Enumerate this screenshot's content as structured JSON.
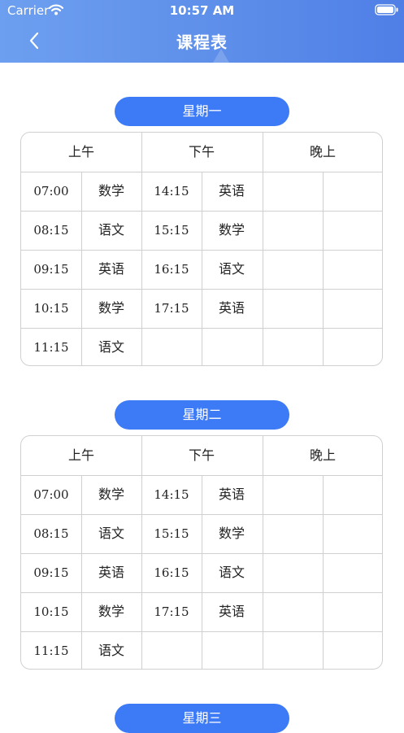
{
  "status_bar": {
    "carrier": "Carrier",
    "time": "10:57 AM"
  },
  "header": {
    "title": "课程表"
  },
  "schedule": [
    {
      "day": "星期一",
      "periods": [
        "上午",
        "下午",
        "晚上"
      ],
      "rows": [
        [
          "07:00",
          "数学",
          "14:15",
          "英语",
          "",
          ""
        ],
        [
          "08:15",
          "语文",
          "15:15",
          "数学",
          "",
          ""
        ],
        [
          "09:15",
          "英语",
          "16:15",
          "语文",
          "",
          ""
        ],
        [
          "10:15",
          "数学",
          "17:15",
          "英语",
          "",
          ""
        ],
        [
          "11:15",
          "语文",
          "",
          "",
          "",
          ""
        ]
      ]
    },
    {
      "day": "星期二",
      "periods": [
        "上午",
        "下午",
        "晚上"
      ],
      "rows": [
        [
          "07:00",
          "数学",
          "14:15",
          "英语",
          "",
          ""
        ],
        [
          "08:15",
          "语文",
          "15:15",
          "数学",
          "",
          ""
        ],
        [
          "09:15",
          "英语",
          "16:15",
          "语文",
          "",
          ""
        ],
        [
          "10:15",
          "数学",
          "17:15",
          "英语",
          "",
          ""
        ],
        [
          "11:15",
          "语文",
          "",
          "",
          "",
          ""
        ]
      ]
    },
    {
      "day": "星期三"
    }
  ]
}
